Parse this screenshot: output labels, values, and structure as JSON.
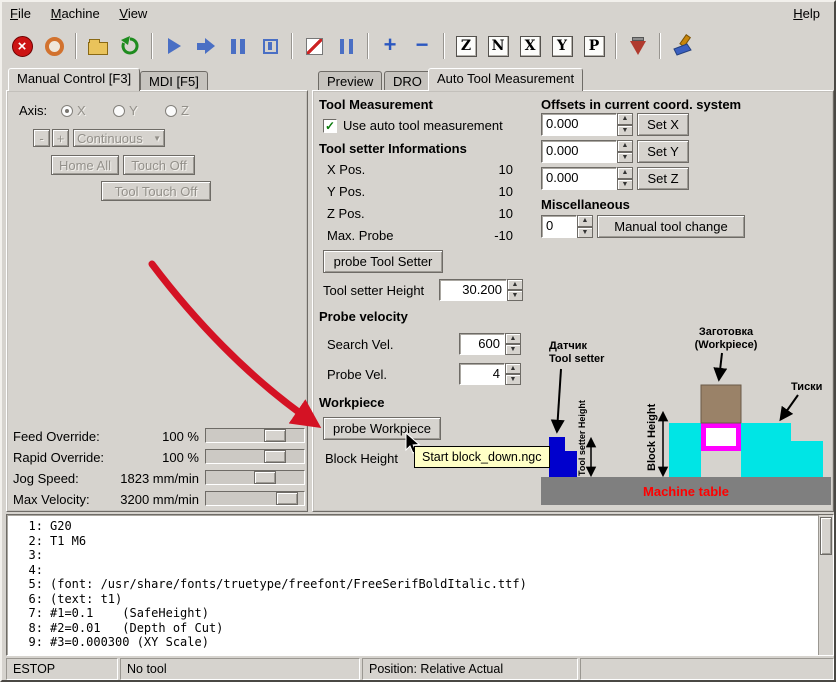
{
  "menubar": {
    "file": "File",
    "machine": "Machine",
    "view": "View",
    "help": "Help"
  },
  "toolbar": {
    "letters": [
      "Z",
      "N",
      "X",
      "Y",
      "P"
    ]
  },
  "left_panel": {
    "tabs": {
      "manual": "Manual Control [F3]",
      "mdi": "MDI [F5]"
    },
    "axis_label": "Axis:",
    "axis_x": "X",
    "axis_y": "Y",
    "axis_z": "Z",
    "jog_minus": "-",
    "jog_plus": "+",
    "jog_mode": "Continuous",
    "home_all": "Home All",
    "touch_off": "Touch Off",
    "tool_touch_off": "Tool Touch Off",
    "overrides": [
      {
        "label": "Feed Override:",
        "value": "100 %"
      },
      {
        "label": "Rapid Override:",
        "value": "100 %"
      },
      {
        "label": "Jog Speed:",
        "value": "1823 mm/min"
      },
      {
        "label": "Max Velocity:",
        "value": "3200 mm/min"
      }
    ]
  },
  "right_panel": {
    "tabs": {
      "preview": "Preview",
      "dro": "DRO",
      "atm": "Auto Tool Measurement"
    },
    "tool_measurement": {
      "title": "Tool Measurement",
      "auto_checkbox_label": "Use auto tool measurement",
      "info_title": "Tool setter Informations",
      "info_rows": [
        {
          "label": "X Pos.",
          "value": "10"
        },
        {
          "label": "Y Pos.",
          "value": "10"
        },
        {
          "label": "Z Pos.",
          "value": "10"
        },
        {
          "label": "Max. Probe",
          "value": "-10"
        }
      ],
      "probe_tool_setter_button": "probe Tool Setter",
      "tool_setter_height_label": "Tool setter Height",
      "tool_setter_height_value": "30.200"
    },
    "probe_velocity": {
      "title": "Probe velocity",
      "search_label": "Search Vel.",
      "search_value": "600",
      "probe_label": "Probe Vel.",
      "probe_value": "4"
    },
    "workpiece": {
      "title": "Workpiece",
      "probe_workpiece_button": "probe Workpiece",
      "block_height_label": "Block Height"
    },
    "offsets": {
      "title": "Offsets in current coord. system",
      "rows": [
        {
          "value": "0.000",
          "button": "Set X"
        },
        {
          "value": "0.000",
          "button": "Set Y"
        },
        {
          "value": "0.000",
          "button": "Set Z"
        }
      ]
    },
    "misc": {
      "title": "Miscellaneous",
      "value": "0",
      "button": "Manual tool change"
    },
    "diagram": {
      "sensor_line1": "Датчик",
      "sensor_line2": "Tool setter",
      "workpiece_line1": "Заготовка",
      "workpiece_line2": "(Workpiece)",
      "vise_label": "Тиски",
      "tool_setter_height": "Tool setter Height",
      "block_height": "Block Height",
      "machine_table": "Machine table"
    }
  },
  "tooltip": {
    "text": "Start block_down.ngc"
  },
  "gcode": {
    "lines": [
      {
        "num": "1:",
        "code": "G20"
      },
      {
        "num": "2:",
        "code": "T1 M6"
      },
      {
        "num": "3:",
        "code": ""
      },
      {
        "num": "4:",
        "code": ""
      },
      {
        "num": "5:",
        "code": "(font: /usr/share/fonts/truetype/freefont/FreeSerifBoldItalic.ttf)"
      },
      {
        "num": "6:",
        "code": "(text: t1)"
      },
      {
        "num": "7:",
        "code": "#1=0.1    (SafeHeight)"
      },
      {
        "num": "8:",
        "code": "#2=0.01   (Depth of Cut)"
      },
      {
        "num": "9:",
        "code": "#3=0.000300 (XY Scale)"
      }
    ]
  },
  "statusbar": {
    "estop": "ESTOP",
    "tool": "No tool",
    "position": "Position: Relative Actual"
  },
  "colors": {
    "window_bg": "#d6d3ce",
    "tooltip_bg": "#ffffc6",
    "annotation_arrow": "#d41224",
    "machine_table_text": "#ff0000",
    "tool_setter_blue": "#0000cd",
    "vise_cyan": "#00e5e5",
    "workpiece_brown": "#9a8268",
    "fixture_magenta": "#ff00ff"
  }
}
